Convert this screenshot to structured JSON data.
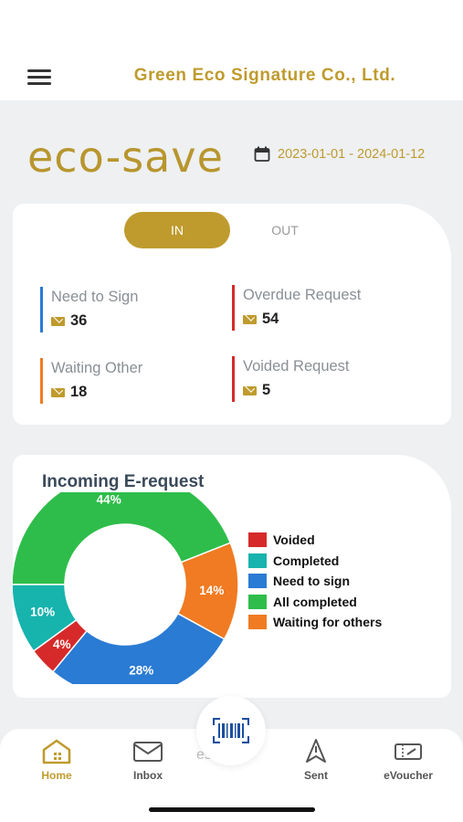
{
  "header": {
    "company": "Green Eco Signature Co., Ltd."
  },
  "brand": {
    "logo_text": "eco-save"
  },
  "date_range": {
    "text": "2023-01-01 - 2024-01-12"
  },
  "toggle": {
    "in_label": "IN",
    "out_label": "OUT",
    "selected": "IN"
  },
  "stats": [
    {
      "label": "Need to Sign",
      "value": "36",
      "color": "#2a7bd4"
    },
    {
      "label": "Overdue Request",
      "value": "54",
      "color": "#d62a2a"
    },
    {
      "label": "Waiting Other",
      "value": "18",
      "color": "#f07b22"
    },
    {
      "label": "Voided Request",
      "value": "5",
      "color": "#d62a2a"
    }
  ],
  "chart_section": {
    "title": "Incoming E-request"
  },
  "chart_data": {
    "type": "pie",
    "categories": [
      "All completed",
      "Waiting for others",
      "Need to sign",
      "Voided",
      "Completed"
    ],
    "values": [
      44,
      14,
      28,
      4,
      10
    ],
    "colors": [
      "#2ebd4a",
      "#f07b22",
      "#2a7bd4",
      "#d62a2a",
      "#17b3ad"
    ],
    "labels": [
      "44%",
      "14%",
      "28%",
      "4%",
      "10%"
    ],
    "legend": [
      {
        "name": "Voided",
        "color": "#d62a2a"
      },
      {
        "name": "Completed",
        "color": "#17b3ad"
      },
      {
        "name": "Need to sign",
        "color": "#2a7bd4"
      },
      {
        "name": "All completed",
        "color": "#2ebd4a"
      },
      {
        "name": "Waiting for others",
        "color": "#f07b22"
      }
    ],
    "legend_position": "right"
  },
  "bottom_nav": {
    "behind_text": "est",
    "items": [
      {
        "label": "Home",
        "icon": "home-icon",
        "active": true
      },
      {
        "label": "Inbox",
        "icon": "inbox-icon"
      },
      {
        "label": "Sent",
        "icon": "sent-icon"
      },
      {
        "label": "eVoucher",
        "icon": "evoucher-icon"
      }
    ],
    "scan_icon": "barcode-scan-icon"
  },
  "colors": {
    "accent": "#bf9b2e",
    "background": "#eef0f2"
  }
}
